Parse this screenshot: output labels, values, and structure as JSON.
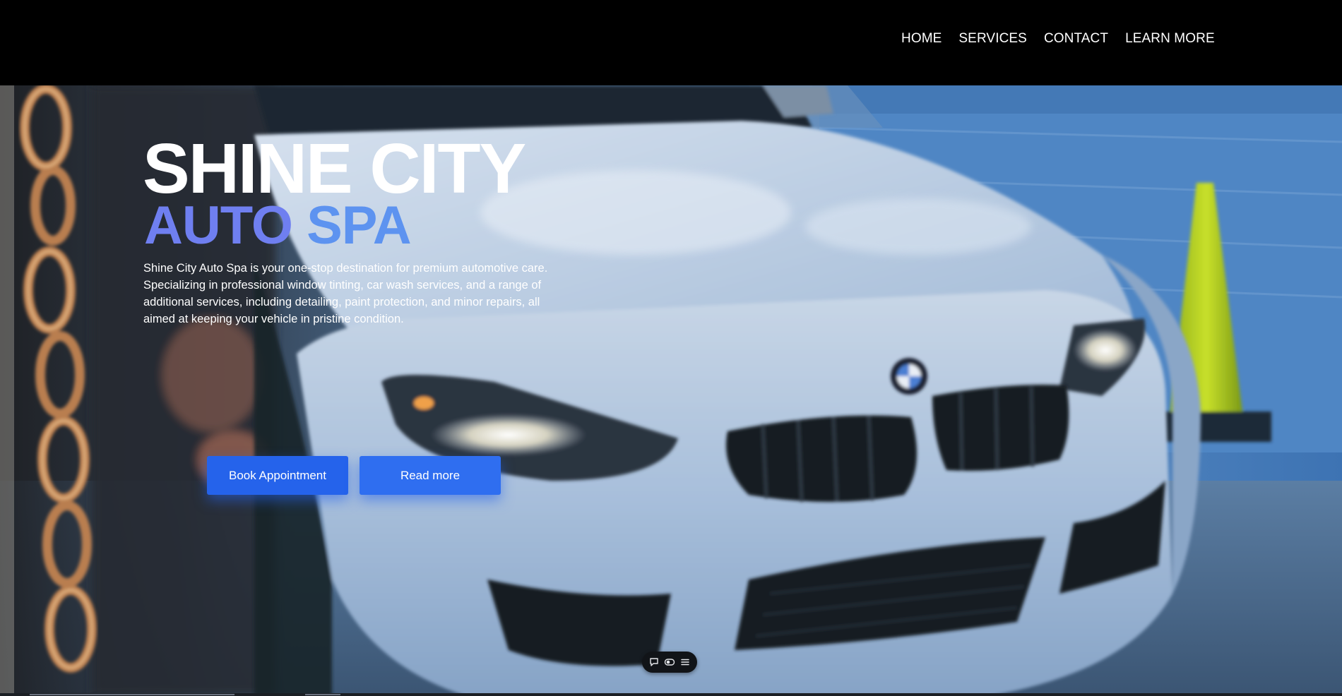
{
  "nav": {
    "items": [
      {
        "label": "HOME"
      },
      {
        "label": "SERVICES"
      },
      {
        "label": "CONTACT"
      },
      {
        "label": "LEARN MORE"
      }
    ]
  },
  "hero": {
    "title_line1": "SHINE CITY",
    "title_line2_a": "AUTO",
    "title_line2_b": "SPA",
    "description": "Shine City Auto Spa is your one-stop destination for premium automotive care. Specializing in professional window tinting, car wash services, and a range of additional services, including detailing, paint protection, and minor repairs, all aimed at keeping your vehicle in pristine condition.",
    "background_image": "white-bmw-car-front-photo",
    "buttons": {
      "book": "Book Appointment",
      "read_more": "Read more"
    }
  },
  "toolbar": {
    "icons": [
      "comment-icon",
      "toggle-icon",
      "menu-icon"
    ]
  },
  "colors": {
    "header_bg": "#000000",
    "title_white": "#ffffff",
    "accent_purple": "#6f7ff0",
    "accent_blue": "#5d93f0",
    "button_blue": "#2563eb"
  }
}
